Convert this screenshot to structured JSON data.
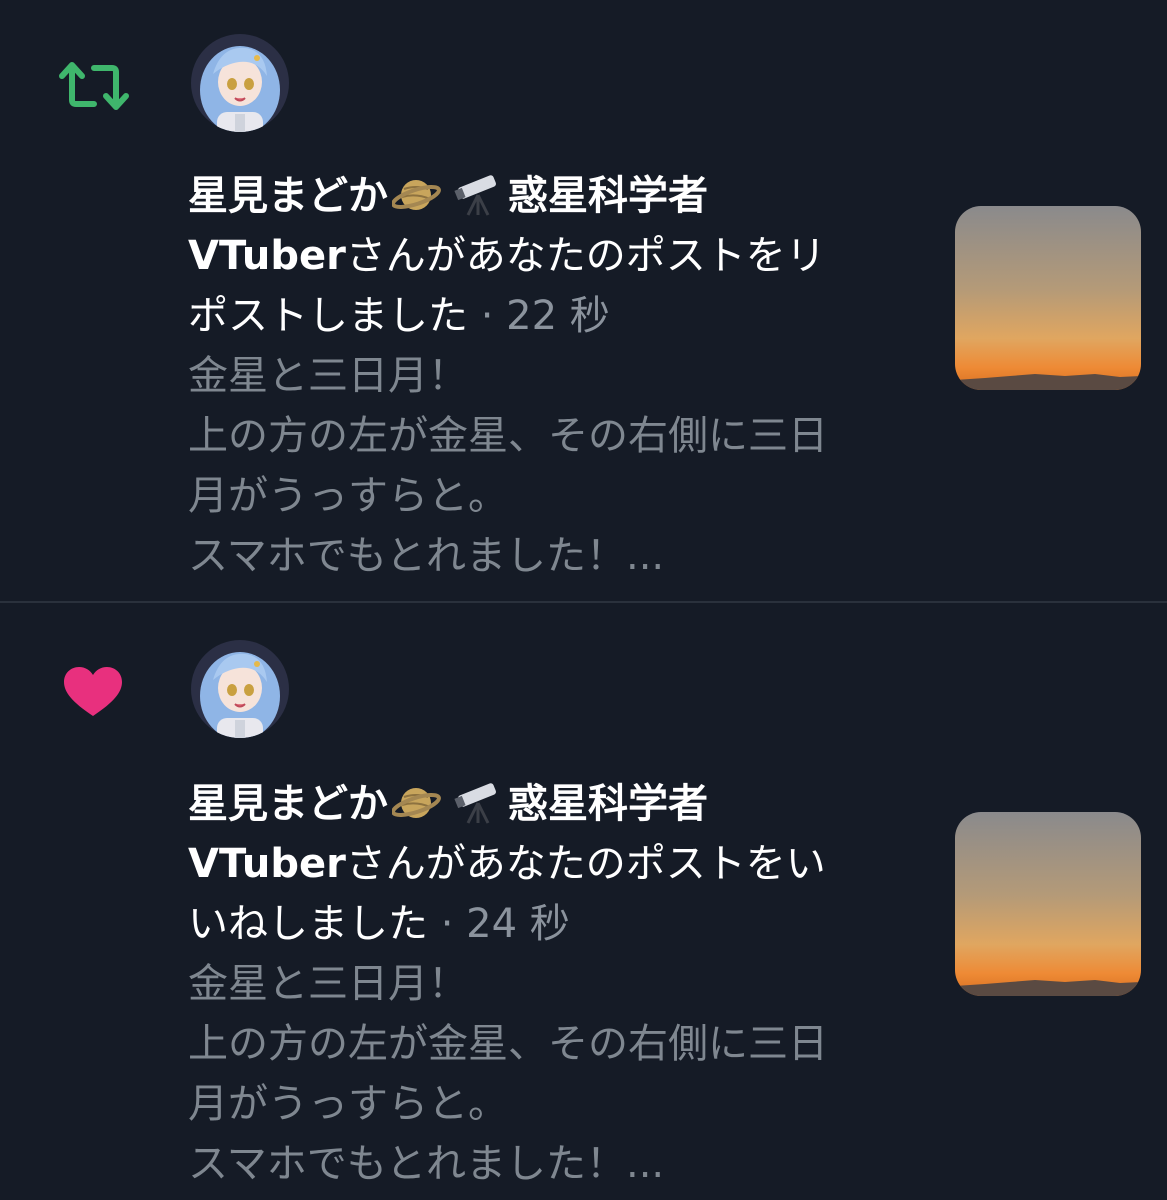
{
  "notifications": [
    {
      "type": "repost",
      "icon": "repost-icon",
      "icon_color": "#3fb66c",
      "name_line": "星見まどか",
      "name_suffix": "惑星科学者",
      "vtuber": "VTuber",
      "action_line_1": "さんがあなたのポストをリ",
      "action_line_2": "ポストしました",
      "separator": "·",
      "time": "22 秒",
      "body": [
        "金星と三日月！",
        "上の方の左が金星、その右側に三日",
        "月がうっすらと。",
        "スマホでもとれました！..."
      ]
    },
    {
      "type": "like",
      "icon": "heart-icon",
      "icon_color": "#e8307e",
      "name_line": "星見まどか",
      "name_suffix": "惑星科学者",
      "vtuber": "VTuber",
      "action_line_1": "さんがあなたのポストをい",
      "action_line_2": "いねしました",
      "separator": "·",
      "time": "24 秒",
      "body": [
        "金星と三日月！",
        "上の方の左が金星、その右側に三日",
        "月がうっすらと。",
        "スマホでもとれました！..."
      ]
    }
  ],
  "colors": {
    "background": "#151b26",
    "divider": "#2a313c",
    "muted_text": "#7f8790"
  }
}
